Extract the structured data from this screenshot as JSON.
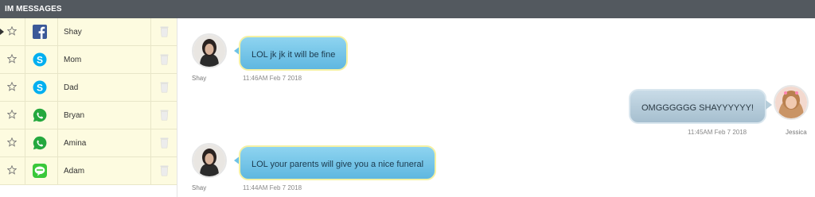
{
  "header": {
    "title": "IM MESSAGES"
  },
  "contacts": [
    {
      "name": "Shay",
      "app": "facebook-icon",
      "selected": true
    },
    {
      "name": "Mom",
      "app": "skype-icon",
      "selected": false
    },
    {
      "name": "Dad",
      "app": "skype-icon",
      "selected": false
    },
    {
      "name": "Bryan",
      "app": "whatsapp-icon",
      "selected": false
    },
    {
      "name": "Amina",
      "app": "whatsapp-icon",
      "selected": false
    },
    {
      "name": "Adam",
      "app": "line-icon",
      "selected": false
    }
  ],
  "messages": [
    {
      "direction": "incoming",
      "sender": "Shay",
      "text": "LOL jk jk it will be fine",
      "time": "11:46AM Feb 7 2018"
    },
    {
      "direction": "outgoing",
      "sender": "Jessica",
      "text": "OMGGGGGG SHAYYYYYY!",
      "time": "11:45AM Feb 7 2018"
    },
    {
      "direction": "incoming",
      "sender": "Shay",
      "text": "LOL your parents will give you a nice funeral",
      "time": "11:44AM Feb 7 2018"
    }
  ],
  "colors": {
    "header_bg": "#53595f",
    "row_bg": "#fdfbe0",
    "bubble_in": "#6ec3e7",
    "bubble_out": "#b6cdda"
  }
}
